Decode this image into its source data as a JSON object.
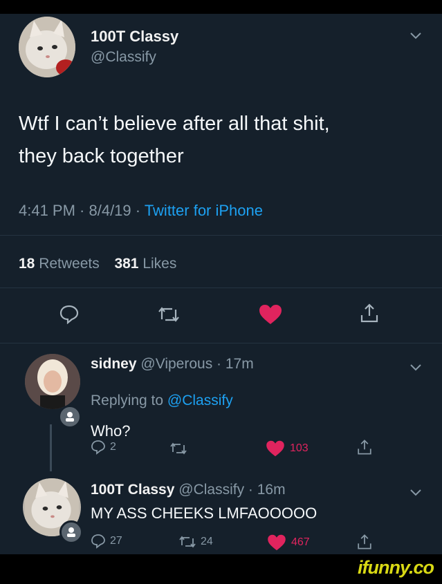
{
  "tweet": {
    "author_name": "100T Classy",
    "author_handle": "@Classify",
    "text_line1": "Wtf I can’t believe after all that shit,",
    "text_line2": "they back together",
    "time": "4:41 PM · 8/4/19 · ",
    "source": "Twitter for iPhone",
    "retweet_count": "18",
    "retweet_label": "Retweets",
    "like_count": "381",
    "like_label": "Likes"
  },
  "replies": [
    {
      "name": "sidney",
      "handle_time": "@Viperous · 17m",
      "replying_prefix": "Replying to ",
      "replying_to": "@Classify",
      "text": "Who?",
      "reply_count": "2",
      "retweet_count": "",
      "like_count": "103"
    },
    {
      "name": "100T Classy",
      "handle_time": "@Classify · 16m",
      "text": "MY ASS CHEEKS LMFAOOOOO",
      "reply_count": "27",
      "retweet_count": "24",
      "like_count": "467"
    }
  ],
  "colors": {
    "background": "#15202b",
    "like_red": "#e0245e",
    "link_blue": "#1da1f2",
    "muted": "#8899a6",
    "ifunny_yellow": "#d9d914"
  },
  "icons": [
    "chevron-down-icon",
    "reply-icon",
    "retweet-icon",
    "heart-icon",
    "share-icon",
    "mic-badge-icon"
  ],
  "watermark": "ifunny.co"
}
